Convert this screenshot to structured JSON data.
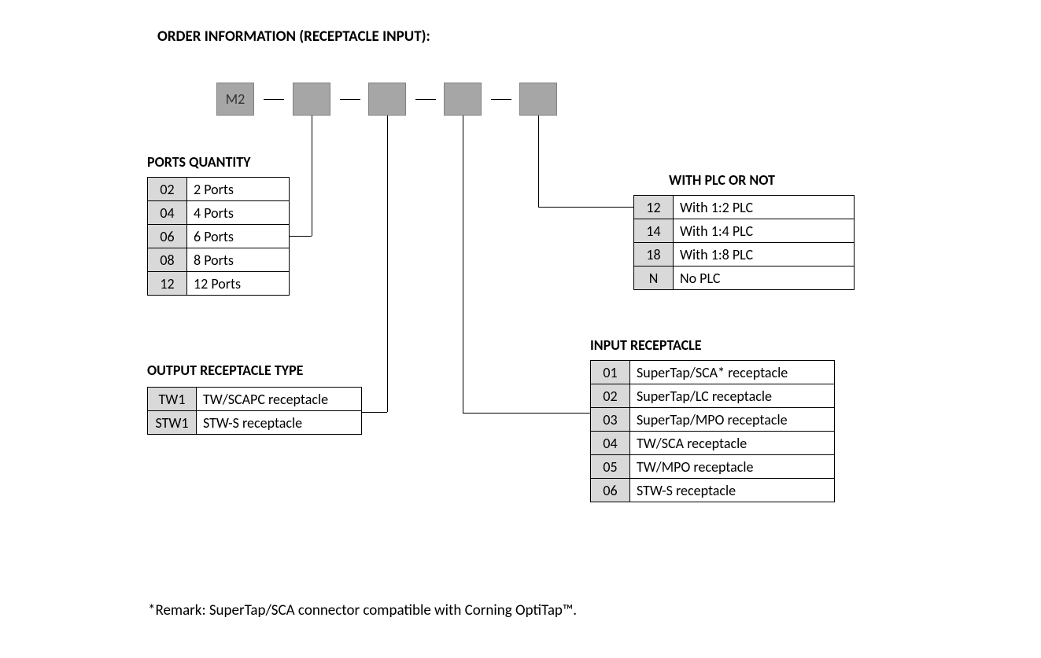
{
  "title": "ORDER INFORMATION (RECEPTACLE INPUT):",
  "prefix": "M2",
  "sections": {
    "ports": {
      "title": "PORTS QUANTITY",
      "rows": [
        {
          "code": "02",
          "desc": "2 Ports"
        },
        {
          "code": "04",
          "desc": "4 Ports"
        },
        {
          "code": "06",
          "desc": "6 Ports"
        },
        {
          "code": "08",
          "desc": "8 Ports"
        },
        {
          "code": "12",
          "desc": "12 Ports"
        }
      ]
    },
    "output": {
      "title": "OUTPUT RECEPTACLE TYPE",
      "rows": [
        {
          "code": "TW1",
          "desc": "TW/SCAPC receptacle"
        },
        {
          "code": "STW1",
          "desc": "STW-S receptacle"
        }
      ]
    },
    "plc": {
      "title": "WITH PLC OR NOT",
      "rows": [
        {
          "code": "12",
          "desc": "With 1:2 PLC"
        },
        {
          "code": "14",
          "desc": "With 1:4 PLC"
        },
        {
          "code": "18",
          "desc": "With 1:8 PLC"
        },
        {
          "code": "N",
          "desc": "No PLC"
        }
      ]
    },
    "input": {
      "title": "INPUT RECEPTACLE",
      "rows": [
        {
          "code": "01",
          "desc": "SuperTap/SCA* receptacle"
        },
        {
          "code": "02",
          "desc": "SuperTap/LC receptacle"
        },
        {
          "code": "03",
          "desc": "SuperTap/MPO receptacle"
        },
        {
          "code": "04",
          "desc": "TW/SCA receptacle"
        },
        {
          "code": "05",
          "desc": "TW/MPO receptacle"
        },
        {
          "code": "06",
          "desc": "STW-S receptacle"
        }
      ]
    }
  },
  "remark": "*Remark: SuperTap/SCA connector compatible with Corning OptiTap™."
}
